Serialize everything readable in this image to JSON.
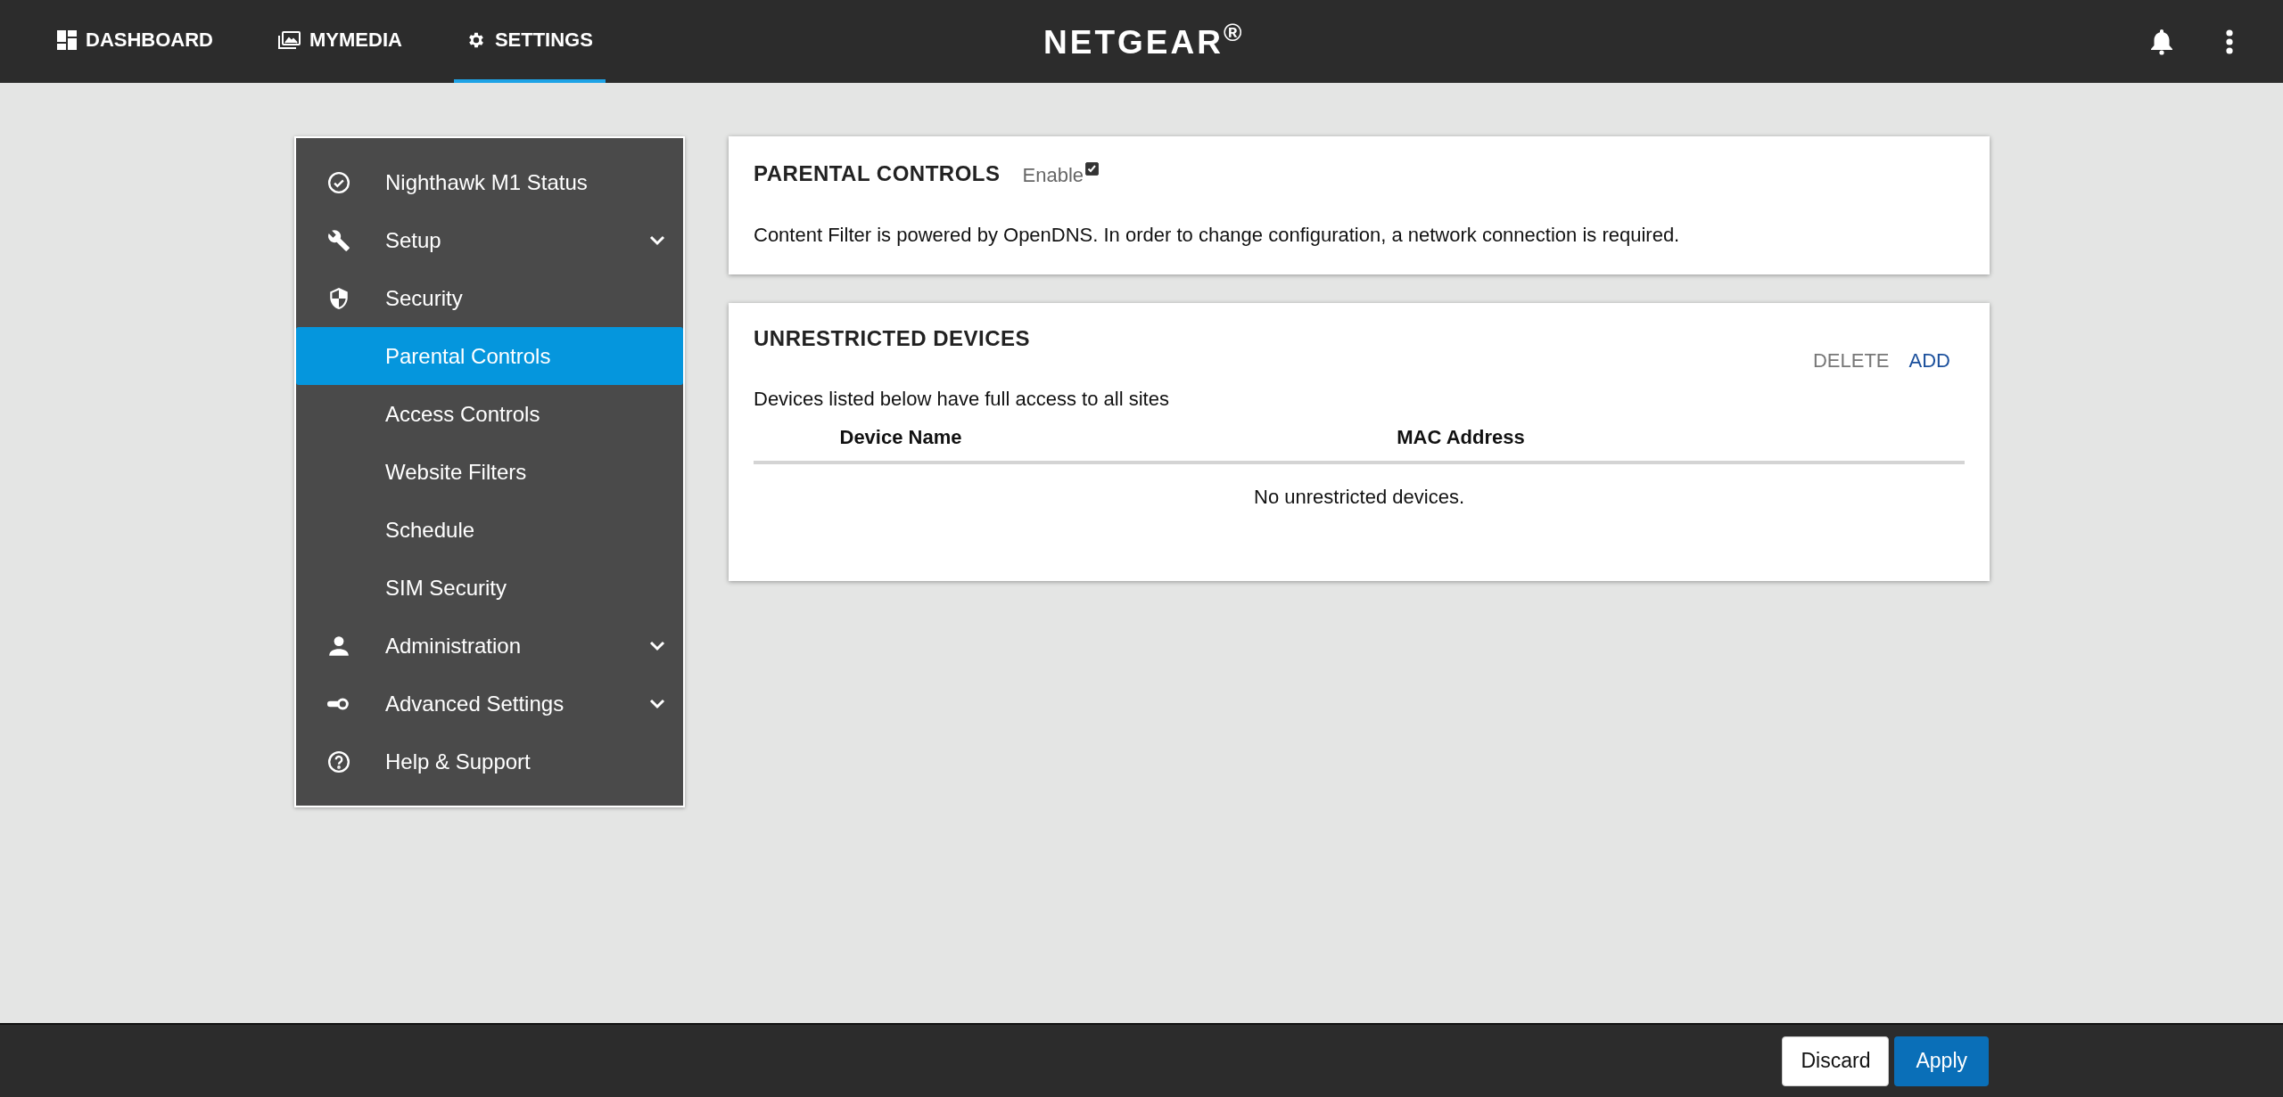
{
  "top_nav": {
    "tabs": [
      {
        "label": "DASHBOARD",
        "selected": false
      },
      {
        "label": "MYMEDIA",
        "selected": false
      },
      {
        "label": "SETTINGS",
        "selected": true
      }
    ],
    "logo": "NETGEAR$^{®}$"
  },
  "sidebar": {
    "items": [
      {
        "label": "Nighthawk M1 Status",
        "selected": false
      },
      {
        "label": "Setup",
        "selected": false,
        "expanded": false
      },
      {
        "label": "Security",
        "selected": false,
        "children": [
          {
            "label": "Parental Controls",
            "selected": true
          },
          {
            "label": "Access Controls",
            "selected": false
          },
          {
            "label": "Website Filters",
            "selected": false
          },
          {
            "label": "Schedule",
            "selected": false
          },
          {
            "label": "SIM Security",
            "selected": false
          }
        ]
      },
      {
        "label": "Administration",
        "selected": false,
        "expanded": false
      },
      {
        "label": "Advanced Settings",
        "selected": false,
        "expanded": false
      },
      {
        "label": "Help & Support",
        "selected": false
      }
    ]
  },
  "parental_controls": {
    "title": "PARENTAL CONTROLS",
    "enable": {
      "label": "Enable",
      "checked": true
    },
    "note": "Content Filter is powered by OpenDNS. In order to change configuration, a network connection is required."
  },
  "unrestricted_devices": {
    "title": "UNRESTRICTED DEVICES",
    "actions": [
      {
        "label": "DELETE",
        "disabled": true
      },
      {
        "label": "ADD",
        "disabled": false
      }
    ],
    "description": "Devices listed below have full access to all sites",
    "table": {
      "columns": [
        "Device Name",
        "MAC Address"
      ],
      "empty_message": "No unrestricted devices."
    }
  },
  "footer": {
    "buttons": [
      {
        "label": "Discard",
        "kind": "secondary"
      },
      {
        "label": "Apply",
        "kind": "primary"
      }
    ]
  }
}
